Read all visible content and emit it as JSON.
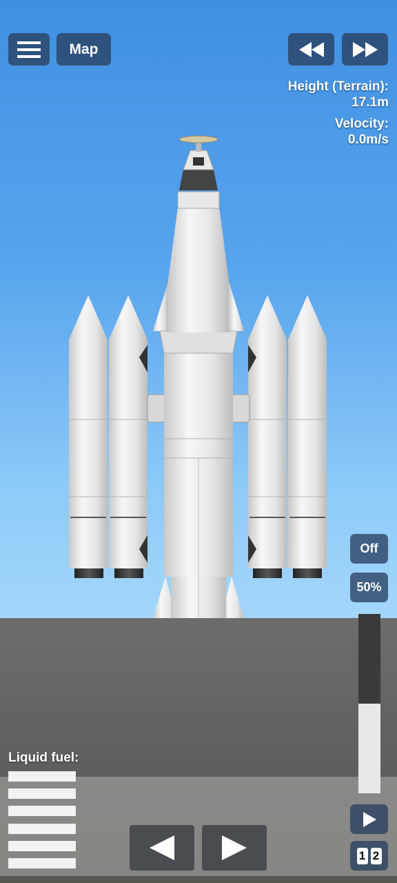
{
  "hud": {
    "menu_icon": "hamburger-menu-icon",
    "map_label": "Map",
    "rewind_icon": "rewind-icon",
    "fast_forward_icon": "fast-forward-icon",
    "height_label": "Height (Terrain):",
    "height_value": "17.1m",
    "velocity_label": "Velocity:",
    "velocity_value": "0.0m/s"
  },
  "controls": {
    "throttle_toggle": "Off",
    "throttle_percent": "50%",
    "throttle_level": 0.5,
    "play_icon": "play-icon",
    "rotate_left_icon": "left-arrow-icon",
    "rotate_right_icon": "right-arrow-icon",
    "stage_digits": [
      "1",
      "2"
    ]
  },
  "fuel": {
    "label": "Liquid fuel:",
    "bar_count": 6
  },
  "colors": {
    "sky_top": "#3f90e2",
    "sky_bottom": "#a4d6fb",
    "ground": "#6d6c6a",
    "button_bg": "#284060"
  }
}
